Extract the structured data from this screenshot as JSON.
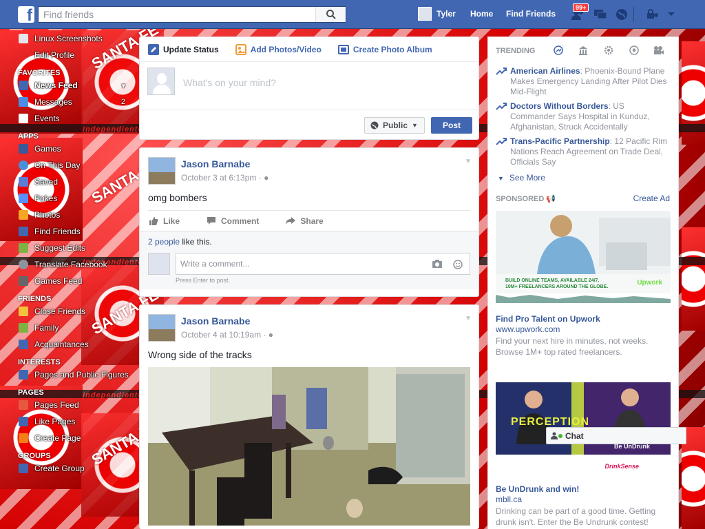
{
  "topbar": {
    "logo": "f",
    "search_placeholder": "Find friends",
    "user_name": "Tyler",
    "home": "Home",
    "find_friends": "Find Friends",
    "friend_requests_badge": "99+"
  },
  "background": {
    "crest_text": "SANTA FE",
    "band_text": "Independiente Santa Fe"
  },
  "leftnav": {
    "items_top": [
      {
        "label": "Linux Screenshots",
        "color": "#e4e6eb"
      },
      {
        "label": "Edit Profile",
        "color": "#e4e6eb"
      }
    ],
    "favorites_head": "FAVORITES",
    "favorites": [
      {
        "label": "News Feed",
        "color": "#4267b2",
        "count": ""
      },
      {
        "label": "Messages",
        "color": "#4b8ee8",
        "count": "2"
      },
      {
        "label": "Events",
        "color": "#ffffff",
        "count": ""
      }
    ],
    "apps_head": "APPS",
    "apps": [
      {
        "label": "Games",
        "color": "#3b5998"
      },
      {
        "label": "On This Day",
        "color": "#4a90d9"
      },
      {
        "label": "Saved",
        "color": "#5b7bd5"
      },
      {
        "label": "Pokes",
        "color": "#5890ff"
      },
      {
        "label": "Photos",
        "color": "#f5a623"
      },
      {
        "label": "Find Friends",
        "color": "#4267b2"
      },
      {
        "label": "Suggest Edits",
        "color": "#7cb342"
      },
      {
        "label": "Translate Facebook",
        "color": "#8d949e"
      },
      {
        "label": "Games Feed",
        "color": "#666666"
      }
    ],
    "friends_head": "FRIENDS",
    "friends": [
      {
        "label": "Close Friends",
        "color": "#f5c33b"
      },
      {
        "label": "Family",
        "color": "#7cb342"
      },
      {
        "label": "Acquaintances",
        "color": "#4267b2"
      }
    ],
    "interests_head": "INTERESTS",
    "interests": [
      {
        "label": "Pages and Public Figures",
        "color": "#4267b2"
      }
    ],
    "pages_head": "PAGES",
    "pages": [
      {
        "label": "Pages Feed",
        "color": "#e9573f"
      },
      {
        "label": "Like Pages",
        "color": "#4267b2"
      },
      {
        "label": "Create Page",
        "color": "#f57f17"
      }
    ],
    "groups_head": "GROUPS",
    "groups": [
      {
        "label": "Create Group",
        "color": "#4267b2"
      }
    ]
  },
  "composer": {
    "tabs": [
      "Update Status",
      "Add Photos/Video",
      "Create Photo Album"
    ],
    "placeholder": "What's on your mind?",
    "privacy": "Public",
    "post": "Post"
  },
  "posts": [
    {
      "author": "Jason Barnabe",
      "time": "October 3 at 6:13pm · ",
      "text": "omg bombers",
      "actions": [
        "Like",
        "Comment",
        "Share"
      ],
      "likes_link": "2 people",
      "likes_rest": " like this.",
      "comment_placeholder": "Write a comment...",
      "hint": "Press Enter to post."
    },
    {
      "author": "Jason Barnabe",
      "time": "October 4 at 10:19am · ",
      "text": "Wrong side of the tracks"
    }
  ],
  "trending": {
    "head": "TRENDING",
    "items": [
      {
        "topic": "American Airlines",
        "desc": ": Phoenix-Bound Plane Makes Emergency Landing After Pilot Dies Mid-Flight"
      },
      {
        "topic": "Doctors Without Borders",
        "desc": ": US Commander Says Hospital in Kunduz, Afghanistan, Struck Accidentally"
      },
      {
        "topic": "Trans-Pacific Partnership",
        "desc": ": 12 Pacific Rim Nations Reach Agreement on Trade Deal, Officials Say"
      }
    ],
    "see_more": "See More"
  },
  "sponsored": {
    "head": "SPONSORED",
    "create_ad": "Create Ad",
    "ads": [
      {
        "banner_line1": "BUILD ONLINE TEAMS, AVAILABLE 24/7.",
        "banner_line2": "10M+ FREELANCERS AROUND THE GLOBE.",
        "brand": "Upwork",
        "title": "Find Pro Talent on Upwork",
        "url": "www.upwork.com",
        "desc": "Find your next hire in minutes, not weeks. Browse 1M+ top rated freelancers."
      },
      {
        "banner_big": "PERCEPTION",
        "banner_small": "Be UnDrunk",
        "brand": "DrinkSense",
        "title": "Be UnDrunk and win!",
        "url": "mbll.ca",
        "desc": "Drinking can be part of a good time. Getting drunk isn't. Enter the Be Undrunk contest!"
      }
    ]
  },
  "chat": {
    "label": "Chat"
  },
  "colors": {
    "brand": "#4267b2",
    "link": "#365899",
    "bg_red": "#d40000"
  }
}
